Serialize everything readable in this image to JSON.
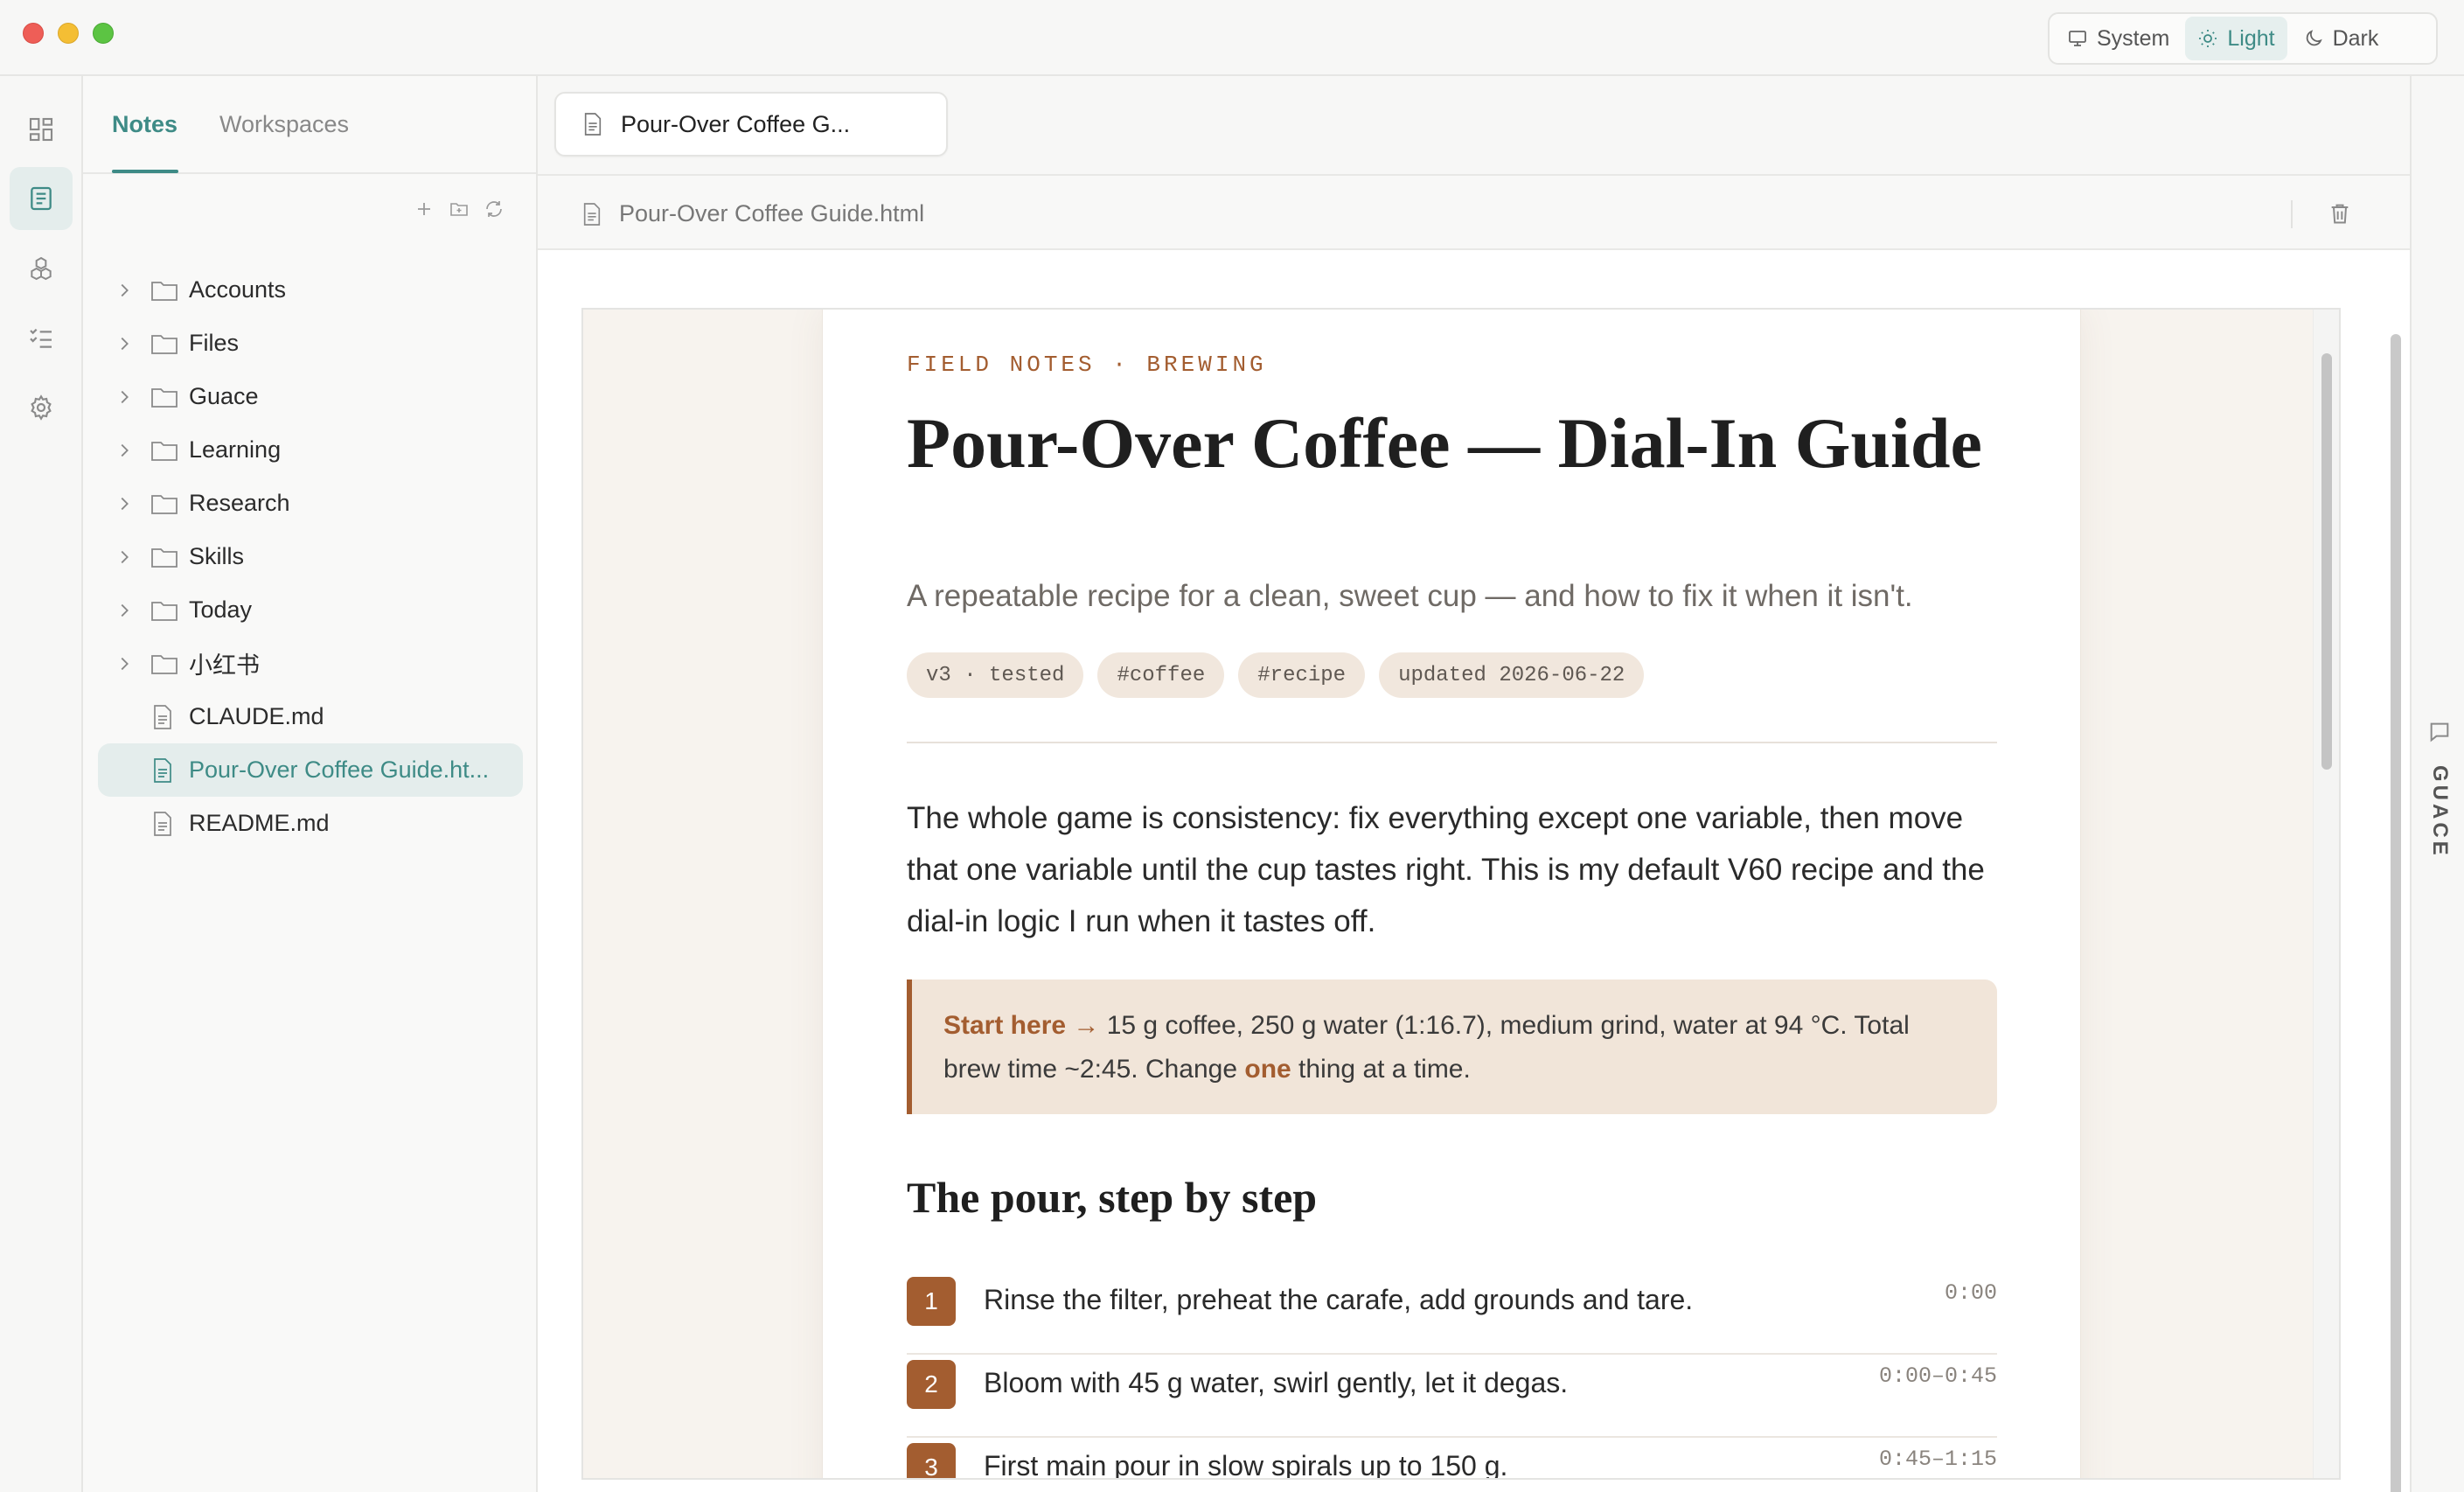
{
  "window": {
    "theme_options": [
      {
        "label": "System",
        "icon": "monitor-icon"
      },
      {
        "label": "Light",
        "icon": "sun-icon",
        "active": true
      },
      {
        "label": "Dark",
        "icon": "moon-icon"
      }
    ]
  },
  "rail": {
    "items": [
      "dashboard-icon",
      "notes-icon",
      "cubes-icon",
      "checklist-icon",
      "settings-icon"
    ],
    "active": "notes-icon"
  },
  "sidebar": {
    "tabs": [
      "Notes",
      "Workspaces"
    ],
    "active_tab": "Notes",
    "actions": [
      "new-file-icon",
      "new-folder-icon",
      "refresh-icon"
    ],
    "folders": [
      "Accounts",
      "Files",
      "Guace",
      "Learning",
      "Research",
      "Skills",
      "Today",
      "小红书"
    ],
    "files": [
      "CLAUDE.md",
      "Pour-Over Coffee Guide.ht...",
      "README.md"
    ],
    "selected_file": "Pour-Over Coffee Guide.ht..."
  },
  "editor": {
    "tab_title": "Pour-Over Coffee G...",
    "path": "Pour-Over Coffee Guide.html"
  },
  "document": {
    "eyebrow": "FIELD NOTES · BREWING",
    "title": "Pour-Over Coffee — Dial-In Guide",
    "subtitle": "A repeatable recipe for a clean, sweet cup — and how to fix it when it isn't.",
    "tags": [
      "v3 · tested",
      "#coffee",
      "#recipe",
      "updated 2026-06-22"
    ],
    "intro": "The whole game is consistency: fix everything except one variable, then move that one variable until the cup tastes right. This is my default V60 recipe and the dial-in logic I run when it tastes off.",
    "callout": {
      "lead": "Start here →",
      "text_before": " 15 g coffee, 250 g water (1:16.7), medium grind, water at 94 °C. Total brew time ~2:45. Change ",
      "emphasis": "one",
      "text_after": " thing at a time."
    },
    "section_heading": "The pour, step by step",
    "steps": [
      {
        "num": "1",
        "text": "Rinse the filter, preheat the carafe, add grounds and tare.",
        "time": "0:00"
      },
      {
        "num": "2",
        "text": "Bloom with 45 g water, swirl gently, let it degas.",
        "time": "0:00–0:45"
      },
      {
        "num": "3",
        "text": "First main pour in slow spirals up to 150 g.",
        "time": "0:45–1:15"
      }
    ]
  },
  "side_panel": {
    "label": "GUACE"
  },
  "colors": {
    "accent": "#3e8b86",
    "brand_brown": "#a35d30"
  }
}
